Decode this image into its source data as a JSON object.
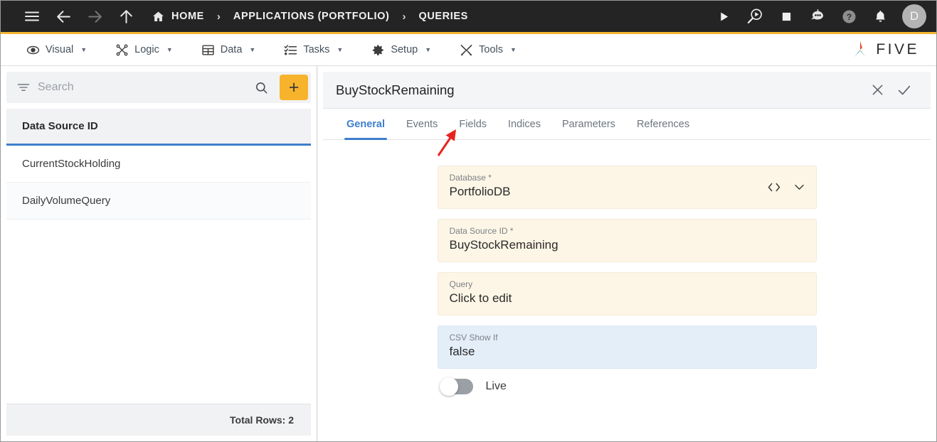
{
  "topbar": {
    "menu_icon": "hamburger-icon",
    "back_icon": "arrow-left-icon",
    "forward_icon": "arrow-right-icon",
    "up_icon": "arrow-up-icon",
    "home_icon": "home-icon",
    "breadcrumb": [
      {
        "label": "HOME"
      },
      {
        "label": "APPLICATIONS (PORTFOLIO)"
      },
      {
        "label": "QUERIES"
      }
    ],
    "separator": "›",
    "actions": [
      {
        "name": "run-icon"
      },
      {
        "name": "debug-icon"
      },
      {
        "name": "stop-icon"
      },
      {
        "name": "bot-icon"
      },
      {
        "name": "help-icon"
      },
      {
        "name": "notifications-icon"
      }
    ],
    "avatar_initial": "D"
  },
  "menubar": {
    "items": [
      {
        "label": "Visual",
        "icon": "eye-icon",
        "caret": "▼"
      },
      {
        "label": "Logic",
        "icon": "logic-icon",
        "caret": "▼"
      },
      {
        "label": "Data",
        "icon": "table-icon",
        "caret": "▼"
      },
      {
        "label": "Tasks",
        "icon": "checklist-icon",
        "caret": "▼"
      },
      {
        "label": "Setup",
        "icon": "gear-icon",
        "caret": "▼"
      },
      {
        "label": "Tools",
        "icon": "tools-icon",
        "caret": "▼"
      }
    ],
    "logo_text": "FIVE",
    "logo_icon": "five-star-logo",
    "accent_color": "#f5b731"
  },
  "sidebar": {
    "search": {
      "placeholder": "Search",
      "value": "",
      "filter_icon": "filter-icon",
      "search_icon": "search-icon"
    },
    "add_button_label": "+",
    "add_button_color": "#f7b32b",
    "list_header": "Data Source ID",
    "header_underline_color": "#3d7fcc",
    "rows": [
      {
        "label": "CurrentStockHolding"
      },
      {
        "label": "DailyVolumeQuery"
      }
    ],
    "footer": "Total Rows: 2"
  },
  "detail": {
    "title": "BuyStockRemaining",
    "close_icon": "close-icon",
    "confirm_icon": "check-icon",
    "tabs": [
      {
        "label": "General",
        "active": true
      },
      {
        "label": "Events",
        "active": false
      },
      {
        "label": "Fields",
        "active": false
      },
      {
        "label": "Indices",
        "active": false
      },
      {
        "label": "Parameters",
        "active": false
      },
      {
        "label": "References",
        "active": false
      }
    ],
    "active_tab_color": "#3d7fcc",
    "fields": [
      {
        "label": "Database",
        "required": true,
        "value": "PortfolioDB",
        "style": "cream",
        "icons": [
          "code-icon",
          "chevron-down-icon"
        ]
      },
      {
        "label": "Data Source ID",
        "required": true,
        "value": "BuyStockRemaining",
        "style": "cream",
        "icons": []
      },
      {
        "label": "Query",
        "required": false,
        "value": "Click to edit",
        "style": "cream",
        "icons": []
      },
      {
        "label": "CSV Show If",
        "required": false,
        "value": "false",
        "style": "blue",
        "icons": []
      }
    ],
    "toggle": {
      "label": "Live",
      "on": false
    }
  },
  "annotation": {
    "type": "arrow",
    "color": "#e8231e",
    "points_to": "Fields"
  }
}
